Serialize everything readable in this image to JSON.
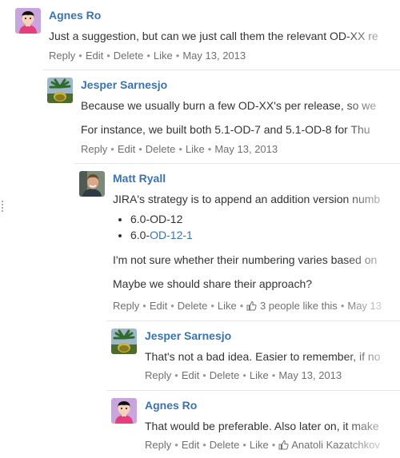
{
  "comments": [
    {
      "author": "Agnes Ro",
      "text": "Just a suggestion, but can we just call them the relevant OD-XX re",
      "actions": {
        "reply": "Reply",
        "edit": "Edit",
        "delete": "Delete",
        "like": "Like",
        "date": "May 13, 2013"
      }
    },
    {
      "author": "Jesper Sarnesjo",
      "text_1": "Because we usually burn a few OD-XX's per release, so we",
      "text_2": "For instance, we built both 5.1-OD-7 and 5.1-OD-8 for Thu",
      "actions": {
        "reply": "Reply",
        "edit": "Edit",
        "delete": "Delete",
        "like": "Like",
        "date": "May 13, 2013"
      }
    },
    {
      "author": "Matt Ryall",
      "text_1": "JIRA's strategy is to append an addition version numb",
      "list": [
        {
          "prefix": "6.0-OD-12",
          "link": ""
        },
        {
          "prefix": "6.0-",
          "link": "OD-12-1"
        }
      ],
      "text_2": "I'm not sure whether their numbering varies based on",
      "text_3": "Maybe we should share their approach?",
      "actions": {
        "reply": "Reply",
        "edit": "Edit",
        "delete": "Delete",
        "like": "Like",
        "likes": "3 people like this",
        "date": "May 13"
      }
    },
    {
      "author": "Jesper Sarnesjo",
      "text": "That's not a bad idea. Easier to remember, if no",
      "actions": {
        "reply": "Reply",
        "edit": "Edit",
        "delete": "Delete",
        "like": "Like",
        "date": "May 13, 2013"
      }
    },
    {
      "author": "Agnes Ro",
      "text": "That would be preferable. Also later on, it make",
      "actions": {
        "reply": "Reply",
        "edit": "Edit",
        "delete": "Delete",
        "like": "Like",
        "likes": "Anatoli Kazatchkov"
      }
    }
  ],
  "colors": {
    "link": "#3b73af",
    "meta": "#707070",
    "border": "#e6e6e6"
  },
  "icons": [
    "female-avatar-icon",
    "tree-avatar-icon",
    "male-photo-avatar-icon",
    "thumbs-up-icon",
    "drag-handle-icon"
  ]
}
